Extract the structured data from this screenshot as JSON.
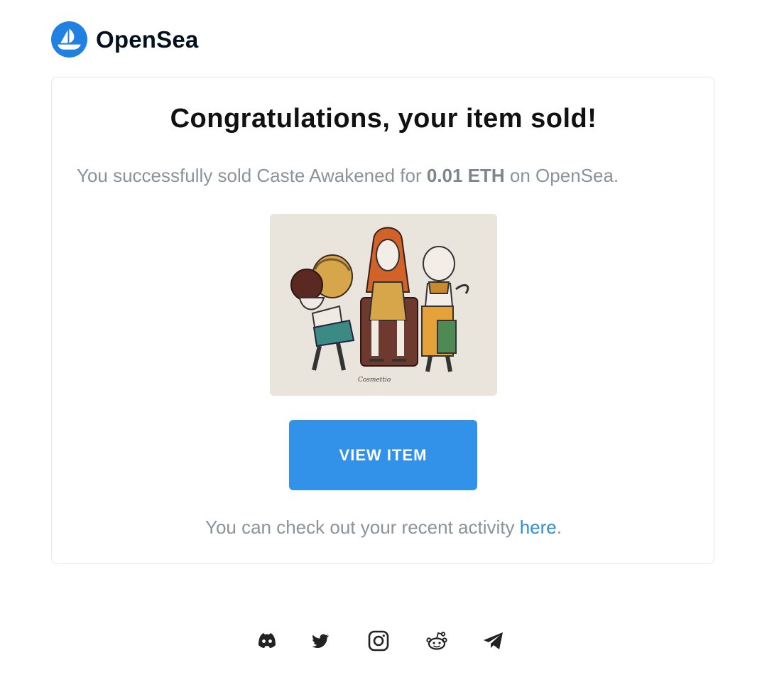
{
  "header": {
    "brand": "OpenSea",
    "logo_icon": "opensea-logo-icon",
    "brand_color": "#2081e2"
  },
  "card": {
    "title": "Congratulations, your item sold!",
    "sold_prefix": "You successfully sold Caste Awakened for ",
    "price": "0.01 ETH",
    "sold_suffix": " on OpenSea.",
    "image_signature": "Cosmettio",
    "button_label": "VIEW ITEM",
    "button_color": "#3291e8",
    "activity_prefix": "You can check out your recent activity ",
    "activity_link": "here",
    "activity_suffix": "."
  },
  "footer": {
    "socials": [
      {
        "name": "discord-icon"
      },
      {
        "name": "twitter-icon"
      },
      {
        "name": "instagram-icon"
      },
      {
        "name": "reddit-icon"
      },
      {
        "name": "telegram-icon"
      }
    ]
  }
}
